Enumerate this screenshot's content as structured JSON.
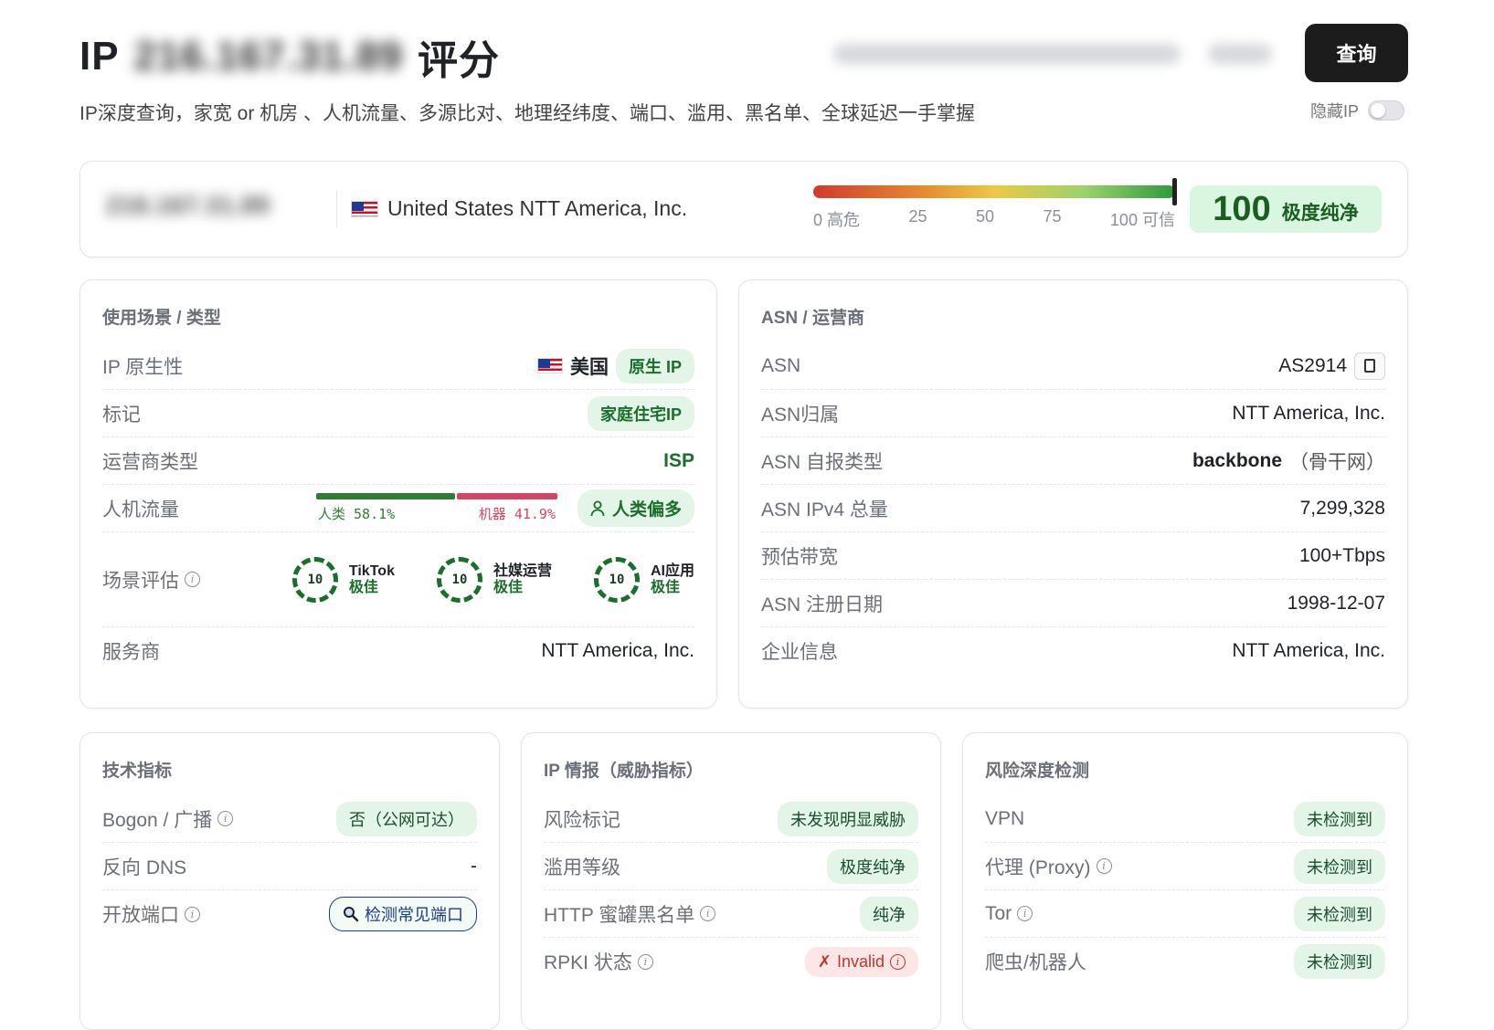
{
  "header": {
    "title_prefix": "IP",
    "title_ip": "216.167.31.89",
    "title_suffix": "评分",
    "subtitle": "IP深度查询，家宽 or 机房 、人机流量、多源比对、地理经纬度、端口、滥用、黑名单、全球延迟一手掌握",
    "query_button": "查询",
    "hide_ip_label": "隐藏IP"
  },
  "summary": {
    "ip": "216.167.31.89",
    "location": "United States NTT America, Inc.",
    "gauge_ticks": [
      "0 高危",
      "25",
      "50",
      "75",
      "100 可信"
    ],
    "score": "100",
    "score_label": "极度纯净",
    "score_value": 100
  },
  "usage": {
    "title": "使用场景 / 类型",
    "nativity_label": "IP 原生性",
    "nativity_country": "美国",
    "nativity_badge": "原生 IP",
    "tag_label": "标记",
    "tag_value": "家庭住宅IP",
    "isp_type_label": "运营商类型",
    "isp_type_value": "ISP",
    "traffic_label": "人机流量",
    "traffic_human": "人类 58.1%",
    "traffic_machine": "机器 41.9%",
    "traffic_human_pct": 58.1,
    "traffic_machine_pct": 41.9,
    "traffic_badge": "人类偏多",
    "scene_label": "场景评估",
    "scenes": [
      {
        "score": "10",
        "name": "TikTok",
        "grade": "极佳"
      },
      {
        "score": "10",
        "name": "社媒运营",
        "grade": "极佳"
      },
      {
        "score": "10",
        "name": "AI应用",
        "grade": "极佳"
      }
    ],
    "provider_label": "服务商",
    "provider_value": "NTT America, Inc."
  },
  "asn": {
    "title": "ASN / 运营商",
    "asn_label": "ASN",
    "asn_value": "AS2914",
    "owner_label": "ASN归属",
    "owner_value": "NTT America, Inc.",
    "type_label": "ASN 自报类型",
    "type_value": "backbone",
    "type_note": "（骨干网）",
    "ipv4_label": "ASN IPv4 总量",
    "ipv4_value": "7,299,328",
    "bandwidth_label": "预估带宽",
    "bandwidth_value": "100+Tbps",
    "reg_label": "ASN 注册日期",
    "reg_value": "1998-12-07",
    "company_label": "企业信息",
    "company_value": "NTT America, Inc."
  },
  "tech": {
    "title": "技术指标",
    "bogon_label": "Bogon / 广播",
    "bogon_value": "否（公网可达）",
    "rdns_label": "反向 DNS",
    "rdns_value": "-",
    "ports_label": "开放端口",
    "ports_button": "检测常见端口"
  },
  "intel": {
    "title": "IP 情报（威胁指标）",
    "risk_label": "风险标记",
    "risk_value": "未发现明显威胁",
    "abuse_label": "滥用等级",
    "abuse_value": "极度纯净",
    "honeypot_label": "HTTP 蜜罐黑名单",
    "honeypot_value": "纯净",
    "rpki_label": "RPKI 状态",
    "rpki_value": "Invalid"
  },
  "risk": {
    "title": "风险深度检测",
    "vpn_label": "VPN",
    "vpn_value": "未检测到",
    "proxy_label": "代理 (Proxy)",
    "proxy_value": "未检测到",
    "tor_label": "Tor",
    "tor_value": "未检测到",
    "bot_label": "爬虫/机器人",
    "bot_value": "未检测到"
  },
  "icons": [
    "us-flag-icon",
    "info-icon",
    "copy-icon",
    "user-icon",
    "search-icon",
    "cross-icon"
  ]
}
